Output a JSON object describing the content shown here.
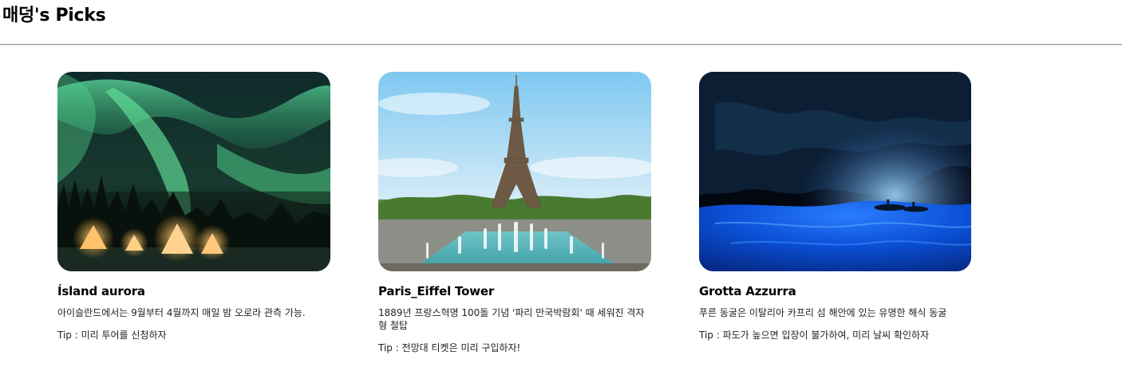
{
  "header": {
    "title": "매덩's Picks"
  },
  "cards": [
    {
      "title": "Ísland aurora",
      "description": "아이슬란드에서는 9월부터 4월까지 매일 밤 오로라 관측 가능.",
      "tip": "Tip : 미리 투어를 신청하자",
      "image_subject": "northern lights over illuminated tents"
    },
    {
      "title": "Paris_Eiffel Tower",
      "description": "1889년 프랑스혁명 100돌 기념 '파리 만국박람회' 때 세워진 격자형 철탑",
      "tip": "Tip : 전망대 티켓은 미리 구입하자!",
      "image_subject": "Eiffel Tower with Trocadéro fountains"
    },
    {
      "title": "Grotta Azzurra",
      "description": "푸른 동굴은 이탈리아 카프리 섬 해안에 있는 유명한 해식 동굴",
      "tip": "Tip : 파도가 높으면 입장이 불가하여, 미리 날씨 확인하자",
      "image_subject": "blue grotto cave with glowing water and boats"
    }
  ]
}
